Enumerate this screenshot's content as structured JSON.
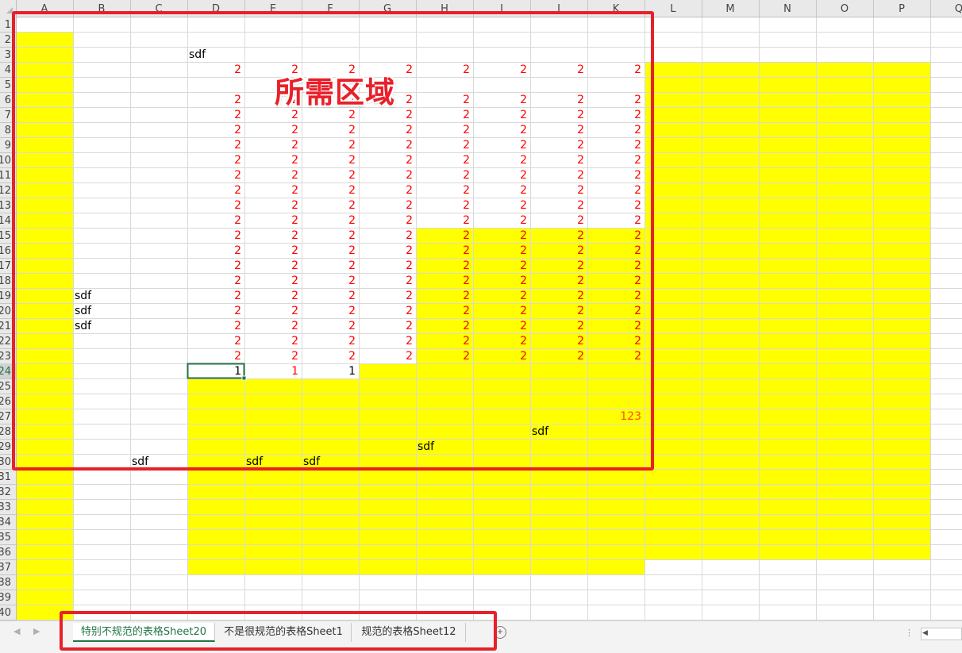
{
  "annotation": {
    "label": "所需区域"
  },
  "columns": [
    "A",
    "B",
    "C",
    "D",
    "E",
    "F",
    "G",
    "H",
    "I",
    "J",
    "K",
    "L",
    "M",
    "N",
    "O",
    "P",
    "Q"
  ],
  "rows": [
    "1",
    "2",
    "3",
    "4",
    "5",
    "6",
    "7",
    "8",
    "9",
    "10",
    "11",
    "12",
    "13",
    "14",
    "15",
    "16",
    "17",
    "18",
    "19",
    "20",
    "21",
    "22",
    "23",
    "24",
    "25",
    "26",
    "27",
    "28",
    "29",
    "30",
    "31",
    "32",
    "33",
    "34",
    "35",
    "36",
    "37",
    "38",
    "39",
    "40"
  ],
  "selected_cell": "D24",
  "colors": {
    "highlight": "#ffff00",
    "red_value": "#ff0000",
    "frame": "#e8202a",
    "selection": "#217346"
  },
  "cells": [
    {
      "ref": "D3",
      "value": "sdf"
    },
    {
      "ref": "D4",
      "value": "2",
      "red": true
    },
    {
      "ref": "E4",
      "value": "2",
      "red": true
    },
    {
      "ref": "F4",
      "value": "2",
      "red": true
    },
    {
      "ref": "G4",
      "value": "2",
      "red": true
    },
    {
      "ref": "H4",
      "value": "2",
      "red": true
    },
    {
      "ref": "I4",
      "value": "2",
      "red": true
    },
    {
      "ref": "J4",
      "value": "2",
      "red": true
    },
    {
      "ref": "K4",
      "value": "2",
      "red": true
    },
    {
      "ref": "D6",
      "value": "2",
      "red": true
    },
    {
      "ref": "E6",
      "value": "2",
      "red": true
    },
    {
      "ref": "F6",
      "value": "2",
      "red": true
    },
    {
      "ref": "G6",
      "value": "2",
      "red": true
    },
    {
      "ref": "H6",
      "value": "2",
      "red": true
    },
    {
      "ref": "I6",
      "value": "2",
      "red": true
    },
    {
      "ref": "J6",
      "value": "2",
      "red": true
    },
    {
      "ref": "K6",
      "value": "2",
      "red": true
    },
    {
      "ref": "D7",
      "value": "2",
      "red": true
    },
    {
      "ref": "E7",
      "value": "2",
      "red": true
    },
    {
      "ref": "F7",
      "value": "2",
      "red": true
    },
    {
      "ref": "G7",
      "value": "2",
      "red": true
    },
    {
      "ref": "H7",
      "value": "2",
      "red": true
    },
    {
      "ref": "I7",
      "value": "2",
      "red": true
    },
    {
      "ref": "J7",
      "value": "2",
      "red": true
    },
    {
      "ref": "K7",
      "value": "2",
      "red": true
    },
    {
      "ref": "D8",
      "value": "2",
      "red": true
    },
    {
      "ref": "E8",
      "value": "2",
      "red": true
    },
    {
      "ref": "F8",
      "value": "2",
      "red": true
    },
    {
      "ref": "G8",
      "value": "2",
      "red": true
    },
    {
      "ref": "H8",
      "value": "2",
      "red": true
    },
    {
      "ref": "I8",
      "value": "2",
      "red": true
    },
    {
      "ref": "J8",
      "value": "2",
      "red": true
    },
    {
      "ref": "K8",
      "value": "2",
      "red": true
    },
    {
      "ref": "D9",
      "value": "2",
      "red": true
    },
    {
      "ref": "E9",
      "value": "2",
      "red": true
    },
    {
      "ref": "F9",
      "value": "2",
      "red": true
    },
    {
      "ref": "G9",
      "value": "2",
      "red": true
    },
    {
      "ref": "H9",
      "value": "2",
      "red": true
    },
    {
      "ref": "I9",
      "value": "2",
      "red": true
    },
    {
      "ref": "J9",
      "value": "2",
      "red": true
    },
    {
      "ref": "K9",
      "value": "2",
      "red": true
    },
    {
      "ref": "D10",
      "value": "2",
      "red": true
    },
    {
      "ref": "E10",
      "value": "2",
      "red": true
    },
    {
      "ref": "F10",
      "value": "2",
      "red": true
    },
    {
      "ref": "G10",
      "value": "2",
      "red": true
    },
    {
      "ref": "H10",
      "value": "2",
      "red": true
    },
    {
      "ref": "I10",
      "value": "2",
      "red": true
    },
    {
      "ref": "J10",
      "value": "2",
      "red": true
    },
    {
      "ref": "K10",
      "value": "2",
      "red": true
    },
    {
      "ref": "D11",
      "value": "2",
      "red": true
    },
    {
      "ref": "E11",
      "value": "2",
      "red": true
    },
    {
      "ref": "F11",
      "value": "2",
      "red": true
    },
    {
      "ref": "G11",
      "value": "2",
      "red": true
    },
    {
      "ref": "H11",
      "value": "2",
      "red": true
    },
    {
      "ref": "I11",
      "value": "2",
      "red": true
    },
    {
      "ref": "J11",
      "value": "2",
      "red": true
    },
    {
      "ref": "K11",
      "value": "2",
      "red": true
    },
    {
      "ref": "D12",
      "value": "2",
      "red": true
    },
    {
      "ref": "E12",
      "value": "2",
      "red": true
    },
    {
      "ref": "F12",
      "value": "2",
      "red": true
    },
    {
      "ref": "G12",
      "value": "2",
      "red": true
    },
    {
      "ref": "H12",
      "value": "2",
      "red": true
    },
    {
      "ref": "I12",
      "value": "2",
      "red": true
    },
    {
      "ref": "J12",
      "value": "2",
      "red": true
    },
    {
      "ref": "K12",
      "value": "2",
      "red": true
    },
    {
      "ref": "D13",
      "value": "2",
      "red": true
    },
    {
      "ref": "E13",
      "value": "2",
      "red": true
    },
    {
      "ref": "F13",
      "value": "2",
      "red": true
    },
    {
      "ref": "G13",
      "value": "2",
      "red": true
    },
    {
      "ref": "H13",
      "value": "2",
      "red": true
    },
    {
      "ref": "I13",
      "value": "2",
      "red": true
    },
    {
      "ref": "J13",
      "value": "2",
      "red": true
    },
    {
      "ref": "K13",
      "value": "2",
      "red": true
    },
    {
      "ref": "D14",
      "value": "2",
      "red": true
    },
    {
      "ref": "E14",
      "value": "2",
      "red": true
    },
    {
      "ref": "F14",
      "value": "2",
      "red": true
    },
    {
      "ref": "G14",
      "value": "2",
      "red": true
    },
    {
      "ref": "H14",
      "value": "2",
      "red": true
    },
    {
      "ref": "I14",
      "value": "2",
      "red": true
    },
    {
      "ref": "J14",
      "value": "2",
      "red": true
    },
    {
      "ref": "K14",
      "value": "2",
      "red": true
    },
    {
      "ref": "D15",
      "value": "2",
      "red": true
    },
    {
      "ref": "E15",
      "value": "2",
      "red": true
    },
    {
      "ref": "F15",
      "value": "2",
      "red": true
    },
    {
      "ref": "G15",
      "value": "2",
      "red": true
    },
    {
      "ref": "H15",
      "value": "2",
      "red": true
    },
    {
      "ref": "I15",
      "value": "2",
      "red": true
    },
    {
      "ref": "J15",
      "value": "2",
      "red": true
    },
    {
      "ref": "K15",
      "value": "2",
      "red": true
    },
    {
      "ref": "D16",
      "value": "2",
      "red": true
    },
    {
      "ref": "E16",
      "value": "2",
      "red": true
    },
    {
      "ref": "F16",
      "value": "2",
      "red": true
    },
    {
      "ref": "G16",
      "value": "2",
      "red": true
    },
    {
      "ref": "H16",
      "value": "2",
      "red": true
    },
    {
      "ref": "I16",
      "value": "2",
      "red": true
    },
    {
      "ref": "J16",
      "value": "2",
      "red": true
    },
    {
      "ref": "K16",
      "value": "2",
      "red": true
    },
    {
      "ref": "D17",
      "value": "2",
      "red": true
    },
    {
      "ref": "E17",
      "value": "2",
      "red": true
    },
    {
      "ref": "F17",
      "value": "2",
      "red": true
    },
    {
      "ref": "G17",
      "value": "2",
      "red": true
    },
    {
      "ref": "H17",
      "value": "2",
      "red": true
    },
    {
      "ref": "I17",
      "value": "2",
      "red": true
    },
    {
      "ref": "J17",
      "value": "2",
      "red": true
    },
    {
      "ref": "K17",
      "value": "2",
      "red": true
    },
    {
      "ref": "D18",
      "value": "2",
      "red": true
    },
    {
      "ref": "E18",
      "value": "2",
      "red": true
    },
    {
      "ref": "F18",
      "value": "2",
      "red": true
    },
    {
      "ref": "G18",
      "value": "2",
      "red": true
    },
    {
      "ref": "H18",
      "value": "2",
      "red": true
    },
    {
      "ref": "I18",
      "value": "2",
      "red": true
    },
    {
      "ref": "J18",
      "value": "2",
      "red": true
    },
    {
      "ref": "K18",
      "value": "2",
      "red": true
    },
    {
      "ref": "B19",
      "value": "sdf"
    },
    {
      "ref": "D19",
      "value": "2",
      "red": true
    },
    {
      "ref": "E19",
      "value": "2",
      "red": true
    },
    {
      "ref": "F19",
      "value": "2",
      "red": true
    },
    {
      "ref": "G19",
      "value": "2",
      "red": true
    },
    {
      "ref": "H19",
      "value": "2",
      "red": true
    },
    {
      "ref": "I19",
      "value": "2",
      "red": true
    },
    {
      "ref": "J19",
      "value": "2",
      "red": true
    },
    {
      "ref": "K19",
      "value": "2",
      "red": true
    },
    {
      "ref": "B20",
      "value": "sdf"
    },
    {
      "ref": "D20",
      "value": "2",
      "red": true
    },
    {
      "ref": "E20",
      "value": "2",
      "red": true
    },
    {
      "ref": "F20",
      "value": "2",
      "red": true
    },
    {
      "ref": "G20",
      "value": "2",
      "red": true
    },
    {
      "ref": "H20",
      "value": "2",
      "red": true
    },
    {
      "ref": "I20",
      "value": "2",
      "red": true
    },
    {
      "ref": "J20",
      "value": "2",
      "red": true
    },
    {
      "ref": "K20",
      "value": "2",
      "red": true
    },
    {
      "ref": "B21",
      "value": "sdf"
    },
    {
      "ref": "D21",
      "value": "2",
      "red": true
    },
    {
      "ref": "E21",
      "value": "2",
      "red": true
    },
    {
      "ref": "F21",
      "value": "2",
      "red": true
    },
    {
      "ref": "G21",
      "value": "2",
      "red": true
    },
    {
      "ref": "H21",
      "value": "2",
      "red": true
    },
    {
      "ref": "I21",
      "value": "2",
      "red": true
    },
    {
      "ref": "J21",
      "value": "2",
      "red": true
    },
    {
      "ref": "K21",
      "value": "2",
      "red": true
    },
    {
      "ref": "D22",
      "value": "2",
      "red": true
    },
    {
      "ref": "E22",
      "value": "2",
      "red": true
    },
    {
      "ref": "F22",
      "value": "2",
      "red": true
    },
    {
      "ref": "G22",
      "value": "2",
      "red": true
    },
    {
      "ref": "H22",
      "value": "2",
      "red": true
    },
    {
      "ref": "I22",
      "value": "2",
      "red": true
    },
    {
      "ref": "J22",
      "value": "2",
      "red": true
    },
    {
      "ref": "K22",
      "value": "2",
      "red": true
    },
    {
      "ref": "D23",
      "value": "2",
      "red": true
    },
    {
      "ref": "E23",
      "value": "2",
      "red": true
    },
    {
      "ref": "F23",
      "value": "2",
      "red": true
    },
    {
      "ref": "G23",
      "value": "2",
      "red": true
    },
    {
      "ref": "H23",
      "value": "2",
      "red": true
    },
    {
      "ref": "I23",
      "value": "2",
      "red": true
    },
    {
      "ref": "J23",
      "value": "2",
      "red": true
    },
    {
      "ref": "K23",
      "value": "2",
      "red": true
    },
    {
      "ref": "D24",
      "value": "1"
    },
    {
      "ref": "E24",
      "value": "1",
      "red": true
    },
    {
      "ref": "F24",
      "value": "1"
    },
    {
      "ref": "K27",
      "value": "123",
      "orange": true
    },
    {
      "ref": "J28",
      "value": "sdf"
    },
    {
      "ref": "H29",
      "value": "sdf"
    },
    {
      "ref": "C30",
      "value": "sdf"
    },
    {
      "ref": "E30",
      "value": "sdf"
    },
    {
      "ref": "F30",
      "value": "sdf"
    }
  ],
  "sheet_tabs": [
    {
      "label": "特别不规范的表格Sheet20",
      "active": true
    },
    {
      "label": "不是很规范的表格Sheet1",
      "active": false
    },
    {
      "label": "规范的表格Sheet12",
      "active": false
    }
  ],
  "tab_nav": {
    "prev": "◀",
    "next": "▶",
    "add": "+",
    "more": "⋮",
    "scroll_left": "◀"
  }
}
